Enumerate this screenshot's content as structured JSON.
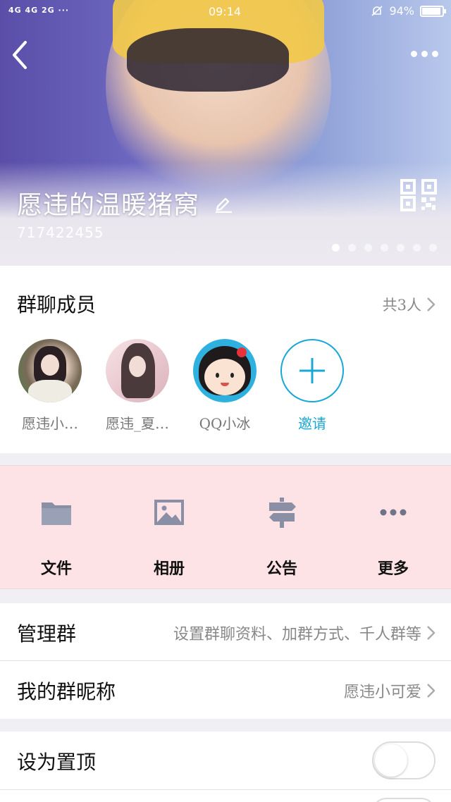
{
  "status_bar": {
    "network": "4G 4G 2G ···",
    "time": "09:14",
    "battery": "94%",
    "battery_level": 0.94
  },
  "header": {
    "group_name": "愿违的温暖猪窝",
    "group_id": "717422455",
    "page_dots": 7,
    "active_dot": 0
  },
  "members": {
    "title": "群聊成员",
    "count_label": "共3人",
    "list": [
      {
        "name": "愿违小…"
      },
      {
        "name": "愿违_夏…"
      },
      {
        "name": "QQ小冰"
      }
    ],
    "invite_label": "邀请"
  },
  "actions": [
    {
      "label": "文件",
      "icon": "folder-icon"
    },
    {
      "label": "相册",
      "icon": "image-icon"
    },
    {
      "label": "公告",
      "icon": "signpost-icon"
    },
    {
      "label": "更多",
      "icon": "more-icon"
    }
  ],
  "settings": {
    "manage": {
      "label": "管理群",
      "value": "设置群聊资料、加群方式、千人群等"
    },
    "nickname": {
      "label": "我的群昵称",
      "value": "愿违小可爱"
    },
    "pin": {
      "label": "设为置顶",
      "on": false
    }
  },
  "colors": {
    "accent": "#19a7d8",
    "actions_bg": "#fde3e5",
    "icon_gray": "#8a8fa6"
  }
}
